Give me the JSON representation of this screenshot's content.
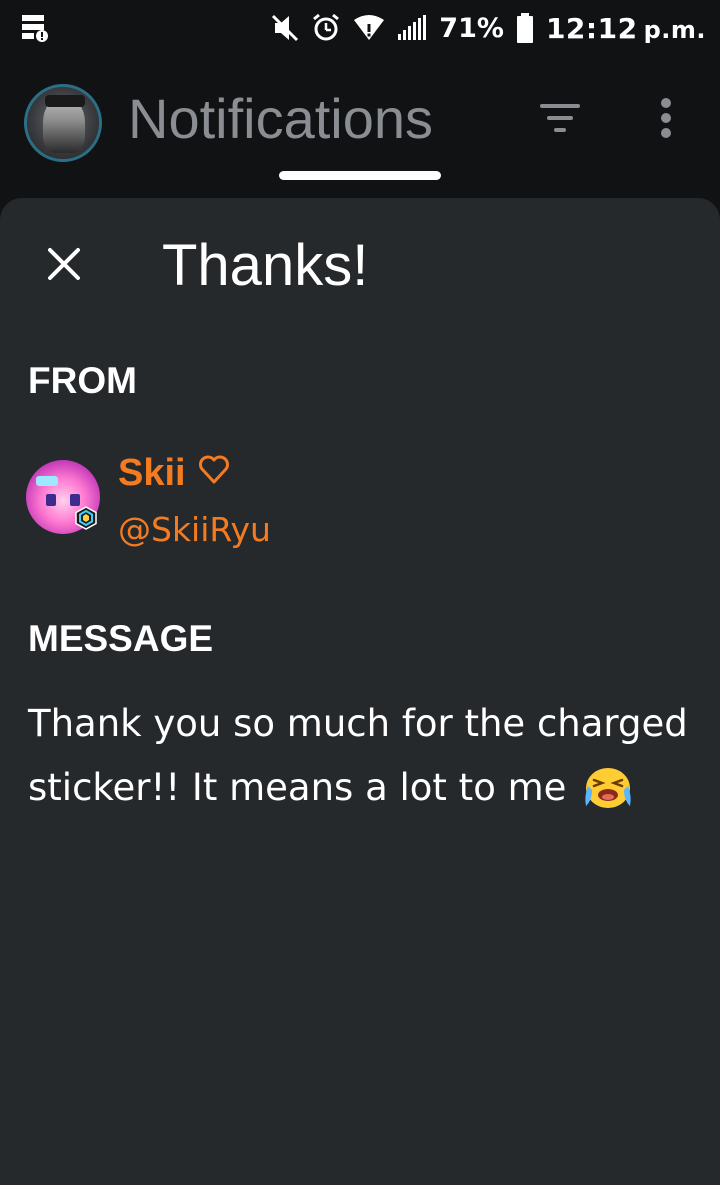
{
  "status_bar": {
    "battery": "71%",
    "time": "12:12",
    "ampm": "p.m."
  },
  "header": {
    "title": "Notifications"
  },
  "sheet": {
    "title": "Thanks!",
    "from_label": "FROM",
    "sender": {
      "name": "Skii",
      "handle": "@SkiiRyu"
    },
    "message_label": "MESSAGE",
    "message_text": "Thank you so much for the charged sticker!! It means a lot to me"
  },
  "colors": {
    "accent_orange": "#f47b20",
    "sheet_bg": "#26292c",
    "app_bg": "#111214"
  },
  "icons": [
    "status-server-icon",
    "mute-icon",
    "alarm-icon",
    "wifi-icon",
    "signal-icon",
    "battery-icon",
    "filter-icon",
    "more-vertical-icon",
    "close-icon",
    "heart-outline-icon",
    "crying-emoji-icon"
  ]
}
